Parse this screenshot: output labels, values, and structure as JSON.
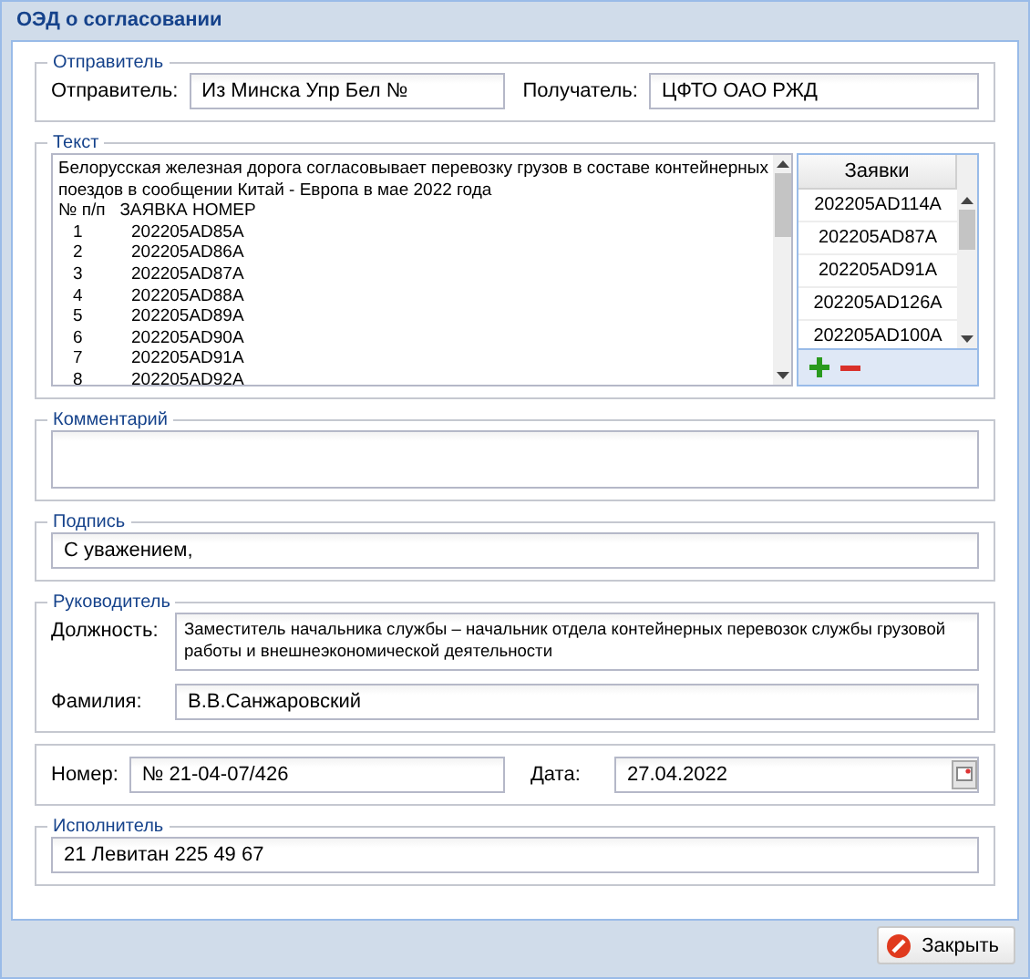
{
  "window": {
    "title": "ОЭД о согласовании"
  },
  "sender": {
    "legend": "Отправитель",
    "sender_label": "Отправитель:",
    "sender_value": "Из Минска Упр Бел №",
    "recipient_label": "Получатель:",
    "recipient_value": "ЦФТО ОАО РЖД"
  },
  "text": {
    "legend": "Текст",
    "intro_lines": [
      "Белорусская железная дорога согласовывает перевозку грузов в составе контейнерных",
      "поездов в сообщении Китай - Европа в мае 2022 года"
    ],
    "header": [
      "№ п/п",
      "ЗАЯВКА НОМЕР"
    ],
    "rows": [
      [
        "1",
        "202205AD85A"
      ],
      [
        "2",
        "202205AD86A"
      ],
      [
        "3",
        "202205AD87A"
      ],
      [
        "4",
        "202205AD88A"
      ],
      [
        "5",
        "202205AD89A"
      ],
      [
        "6",
        "202205AD90A"
      ],
      [
        "7",
        "202205AD91A"
      ],
      [
        "8",
        "202205AD92A"
      ]
    ]
  },
  "requests": {
    "column": "Заявки",
    "rows": [
      "202205AD114A",
      "202205AD87A",
      "202205AD91A",
      "202205AD126A",
      "202205AD100A"
    ]
  },
  "comment": {
    "legend": "Комментарий"
  },
  "signature": {
    "legend": "Подпись",
    "value": "С уважением,"
  },
  "head": {
    "legend": "Руководитель",
    "position_label": "Должность:",
    "position_lines": [
      "Заместитель начальника службы – начальник отдела контейнерных перевозок службы грузовой",
      "работы и внешнеэкономической деятельности"
    ],
    "surname_label": "Фамилия:",
    "surname_value": "В.В.Санжаровский"
  },
  "number": {
    "label": "Номер:",
    "value": "№ 21-04-07/426",
    "date_label": "Дата:",
    "date_value": "27.04.2022"
  },
  "executor": {
    "legend": "Исполнитель",
    "value": "21 Левитан 225 49 67"
  },
  "buttons": [
    {
      "label": "Закрыть"
    }
  ]
}
